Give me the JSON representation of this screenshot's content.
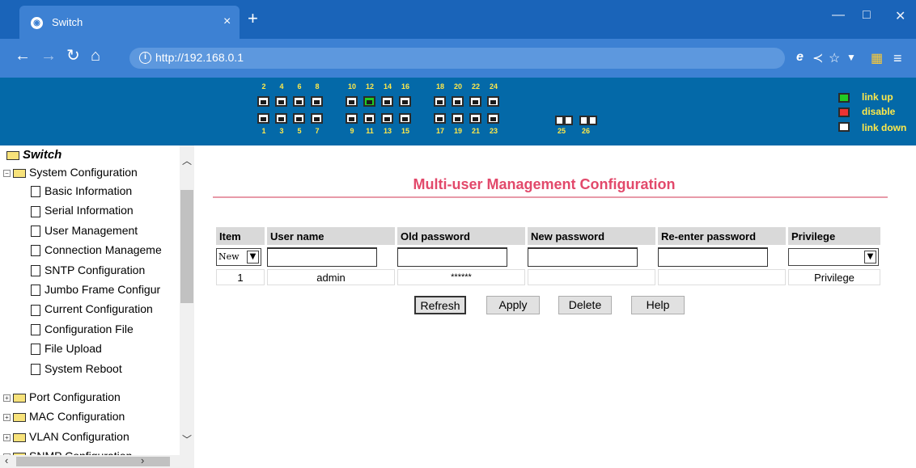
{
  "browser": {
    "tab_title": "Switch",
    "tab_close": "×",
    "new_tab": "+",
    "url": "http://192.168.0.1",
    "window_controls": [
      "—",
      "□",
      "✕"
    ]
  },
  "banner": {
    "top_ports": [
      "2",
      "4",
      "6",
      "8",
      "10",
      "12",
      "14",
      "16",
      "18",
      "20",
      "22",
      "24"
    ],
    "bottom_ports": [
      "1",
      "3",
      "5",
      "7",
      "9",
      "11",
      "13",
      "15",
      "17",
      "19",
      "21",
      "23"
    ],
    "sfp_ports": [
      "25",
      "26"
    ],
    "active_port": "12",
    "legend": {
      "link_up": "link up",
      "disable": "disable",
      "link_down": "link down"
    },
    "colors": {
      "link_up": "#22cc22",
      "disable": "#ee3333",
      "link_down": "#ffffff"
    }
  },
  "sidebar": {
    "root": "Switch",
    "expanded": "System Configuration",
    "children": [
      "Basic Information",
      "Serial Information",
      "User Management",
      "Connection Manageme",
      "SNTP Configuration",
      "Jumbo Frame Configur",
      "Current Configuration",
      "Configuration File",
      "File Upload",
      "System Reboot"
    ],
    "collapsed": [
      "Port Configuration",
      "MAC Configuration",
      "VLAN Configuration",
      "SNMP Configuration"
    ]
  },
  "main": {
    "title": "Multi-user Management Configuration",
    "columns": [
      "Item",
      "User name",
      "Old password",
      "New password",
      "Re-enter password",
      "Privilege"
    ],
    "new_row": {
      "item": "New"
    },
    "rows": [
      {
        "item": "1",
        "user": "admin",
        "old_password": "******",
        "new_password": "",
        "reenter": "",
        "privilege": "Privilege"
      }
    ],
    "buttons": {
      "refresh": "Refresh",
      "apply": "Apply",
      "delete": "Delete",
      "help": "Help"
    }
  }
}
